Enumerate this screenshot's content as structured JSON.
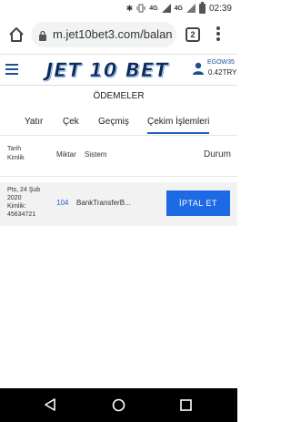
{
  "status_bar": {
    "network": "4G",
    "network_badge": "4G",
    "time": "02:39"
  },
  "browser": {
    "url": "m.jet10bet3.com/balan",
    "tab_count": "2"
  },
  "site": {
    "logo": "JET 10 BET",
    "username": "EGOW35",
    "balance": "0.42TRY"
  },
  "page_title": "ÖDEMELER",
  "tabs": [
    {
      "label": "Yatır"
    },
    {
      "label": "Çek"
    },
    {
      "label": "Geçmiş"
    },
    {
      "label": "Çekim İşlemleri",
      "active": true
    }
  ],
  "table": {
    "headers": {
      "date_line1": "Tarih",
      "date_line2": "Kimlik",
      "amount": "Miktar",
      "system": "Sistem",
      "status": "Durum"
    },
    "rows": [
      {
        "date_line1": "Pts, 24 Şub",
        "date_line2": "2020",
        "id_label": "Kimlik:",
        "id_value": "45634721",
        "amount": "104",
        "system": "BankTransferB...",
        "action": "İPTAL ET"
      }
    ]
  },
  "colors": {
    "accent": "#1d6ae5",
    "link": "#1f5fbf",
    "brand_dark": "#0d2a5c"
  }
}
